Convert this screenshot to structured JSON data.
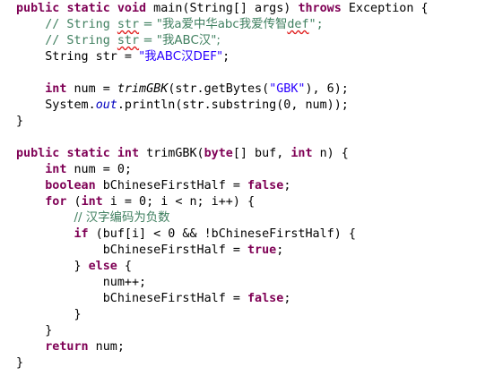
{
  "editor": {
    "lines": [
      {
        "indent": "",
        "tokens": [
          {
            "t": "public",
            "c": "kw"
          },
          {
            "t": " "
          },
          {
            "t": "static",
            "c": "kw"
          },
          {
            "t": " "
          },
          {
            "t": "void",
            "c": "kw"
          },
          {
            "t": " main(String[] args) "
          },
          {
            "t": "throws",
            "c": "kw"
          },
          {
            "t": " Exception {"
          }
        ]
      },
      {
        "indent": "    ",
        "tokens": [
          {
            "t": "// String ",
            "c": "cm"
          },
          {
            "t": "str",
            "c": "cm sq"
          },
          {
            "t": " = \"我a爱中华abc我爱传智",
            "c": "cm"
          },
          {
            "t": "def",
            "c": "cm sq"
          },
          {
            "t": "\";",
            "c": "cm"
          }
        ]
      },
      {
        "indent": "    ",
        "tokens": [
          {
            "t": "// String ",
            "c": "cm"
          },
          {
            "t": "str",
            "c": "cm sq"
          },
          {
            "t": " = \"我ABC汉\";",
            "c": "cm"
          }
        ]
      },
      {
        "indent": "    ",
        "tokens": [
          {
            "t": "String str = "
          },
          {
            "t": "\"我ABC汉DEF\"",
            "c": "st"
          },
          {
            "t": ";"
          }
        ]
      },
      {
        "indent": "",
        "tokens": []
      },
      {
        "indent": "    ",
        "tokens": [
          {
            "t": "int",
            "c": "kw"
          },
          {
            "t": " num = "
          },
          {
            "t": "trimGBK",
            "c": "it"
          },
          {
            "t": "(str.getBytes("
          },
          {
            "t": "\"GBK\"",
            "c": "st"
          },
          {
            "t": "), 6);"
          }
        ]
      },
      {
        "indent": "    ",
        "tokens": [
          {
            "t": "System."
          },
          {
            "t": "out",
            "c": "fd"
          },
          {
            "t": ".println(str.substring(0, num));"
          }
        ]
      },
      {
        "indent": "",
        "tokens": [
          {
            "t": "}"
          }
        ]
      },
      {
        "indent": "",
        "tokens": []
      },
      {
        "indent": "",
        "tokens": [
          {
            "t": "public",
            "c": "kw"
          },
          {
            "t": " "
          },
          {
            "t": "static",
            "c": "kw"
          },
          {
            "t": " "
          },
          {
            "t": "int",
            "c": "kw"
          },
          {
            "t": " trimGBK("
          },
          {
            "t": "byte",
            "c": "kw"
          },
          {
            "t": "[] buf, "
          },
          {
            "t": "int",
            "c": "kw"
          },
          {
            "t": " n) {"
          }
        ]
      },
      {
        "indent": "    ",
        "tokens": [
          {
            "t": "int",
            "c": "kw"
          },
          {
            "t": " num = 0;"
          }
        ]
      },
      {
        "indent": "    ",
        "tokens": [
          {
            "t": "boolean",
            "c": "kw"
          },
          {
            "t": " bChineseFirstHalf = "
          },
          {
            "t": "false",
            "c": "kw"
          },
          {
            "t": ";"
          }
        ]
      },
      {
        "indent": "    ",
        "tokens": [
          {
            "t": "for",
            "c": "kw"
          },
          {
            "t": " ("
          },
          {
            "t": "int",
            "c": "kw"
          },
          {
            "t": " i = 0; i < n; i++) {"
          }
        ]
      },
      {
        "indent": "        ",
        "tokens": [
          {
            "t": "// 汉字编码为负数",
            "c": "cm"
          }
        ]
      },
      {
        "indent": "        ",
        "tokens": [
          {
            "t": "if",
            "c": "kw"
          },
          {
            "t": " (buf[i] < 0 && !bChineseFirstHalf) {"
          }
        ]
      },
      {
        "indent": "            ",
        "tokens": [
          {
            "t": "bChineseFirstHalf = "
          },
          {
            "t": "true",
            "c": "kw"
          },
          {
            "t": ";"
          }
        ]
      },
      {
        "indent": "        ",
        "tokens": [
          {
            "t": "} "
          },
          {
            "t": "else",
            "c": "kw"
          },
          {
            "t": " {"
          }
        ]
      },
      {
        "indent": "            ",
        "tokens": [
          {
            "t": "num++;"
          }
        ]
      },
      {
        "indent": "            ",
        "tokens": [
          {
            "t": "bChineseFirstHalf = "
          },
          {
            "t": "false",
            "c": "kw"
          },
          {
            "t": ";"
          }
        ]
      },
      {
        "indent": "        ",
        "tokens": [
          {
            "t": "}"
          }
        ]
      },
      {
        "indent": "    ",
        "tokens": [
          {
            "t": "}"
          }
        ]
      },
      {
        "indent": "    ",
        "tokens": [
          {
            "t": "return",
            "c": "kw"
          },
          {
            "t": " num;"
          }
        ]
      },
      {
        "indent": "",
        "tokens": [
          {
            "t": "}"
          }
        ]
      }
    ]
  },
  "colors": {
    "keyword": "#7f0055",
    "comment": "#3f7f5f",
    "string": "#2a00ff",
    "field": "#0000c0",
    "squiggle": "#e02020",
    "background": "#ffffff"
  }
}
